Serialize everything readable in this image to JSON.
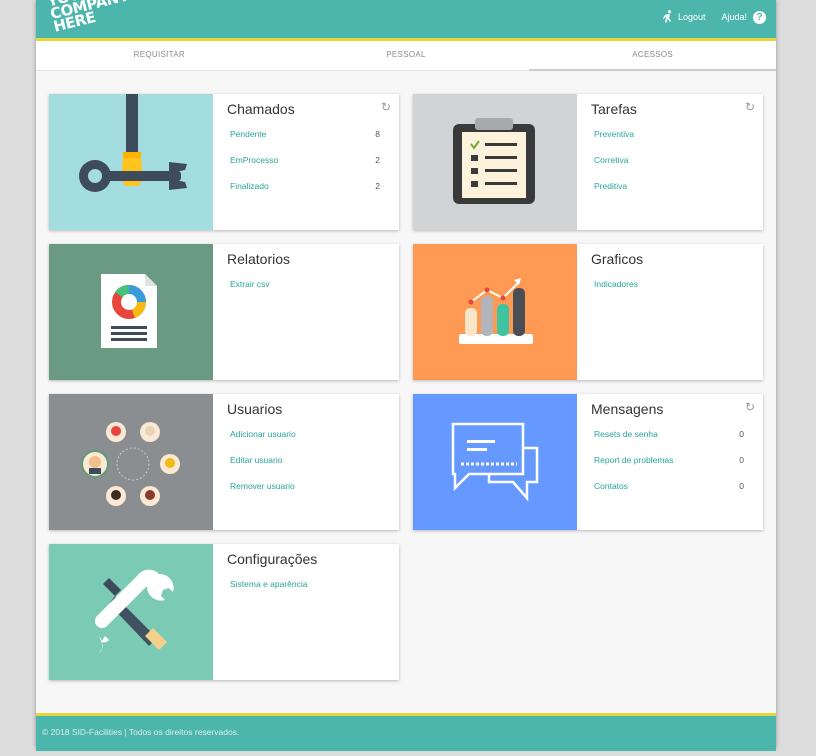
{
  "header": {
    "logo_lines": [
      "YOUR",
      "COMPANY",
      "HERE"
    ],
    "logout_label": "Logout",
    "help_label": "Ajuda!",
    "help_icon": "?"
  },
  "tabs": [
    {
      "label": "REQUISITAR"
    },
    {
      "label": "PESSOAL"
    },
    {
      "label": "ACESSOS"
    }
  ],
  "cards": {
    "chamados": {
      "title": "Chamados",
      "items": [
        {
          "label": "Pendente",
          "count": "8"
        },
        {
          "label": "EmProcesso",
          "count": "2"
        },
        {
          "label": "Finalizado",
          "count": "2"
        }
      ]
    },
    "tarefas": {
      "title": "Tarefas",
      "items": [
        {
          "label": "Preventiva"
        },
        {
          "label": "Corretiva"
        },
        {
          "label": "Preditiva"
        }
      ]
    },
    "relatorios": {
      "title": "Relatorios",
      "items": [
        {
          "label": "Extrair csv"
        }
      ]
    },
    "graficos": {
      "title": "Graficos",
      "items": [
        {
          "label": "Indicadores"
        }
      ]
    },
    "usuarios": {
      "title": "Usuarios",
      "items": [
        {
          "label": "Adicionar usuario"
        },
        {
          "label": "Editar usuario"
        },
        {
          "label": "Remover usuario"
        }
      ]
    },
    "mensagens": {
      "title": "Mensagens",
      "items": [
        {
          "label": "Resets de senha",
          "count": "0"
        },
        {
          "label": "Report de problemas",
          "count": "0"
        },
        {
          "label": "Contatos",
          "count": "0"
        }
      ]
    },
    "configuracoes": {
      "title": "Configurações",
      "items": [
        {
          "label": "Sistema e aparência"
        }
      ]
    }
  },
  "icons": {
    "refresh": "↻"
  },
  "colors": {
    "header_bg": "#4db6ac",
    "header_border": "#e6d63a",
    "link": "#26a69a",
    "chamados_bg": "#a3dde0",
    "tarefas_bg": "#d2d3d5",
    "relatorios_bg": "#6b9a82",
    "graficos_bg": "#ff9a55",
    "usuarios_bg": "#8b8e90",
    "mensagens_bg": "#6699ff",
    "configuracoes_bg": "#7bcab4"
  },
  "footer": {
    "text": "© 2018 SID-Facilities | Todos os direitos reservados."
  }
}
